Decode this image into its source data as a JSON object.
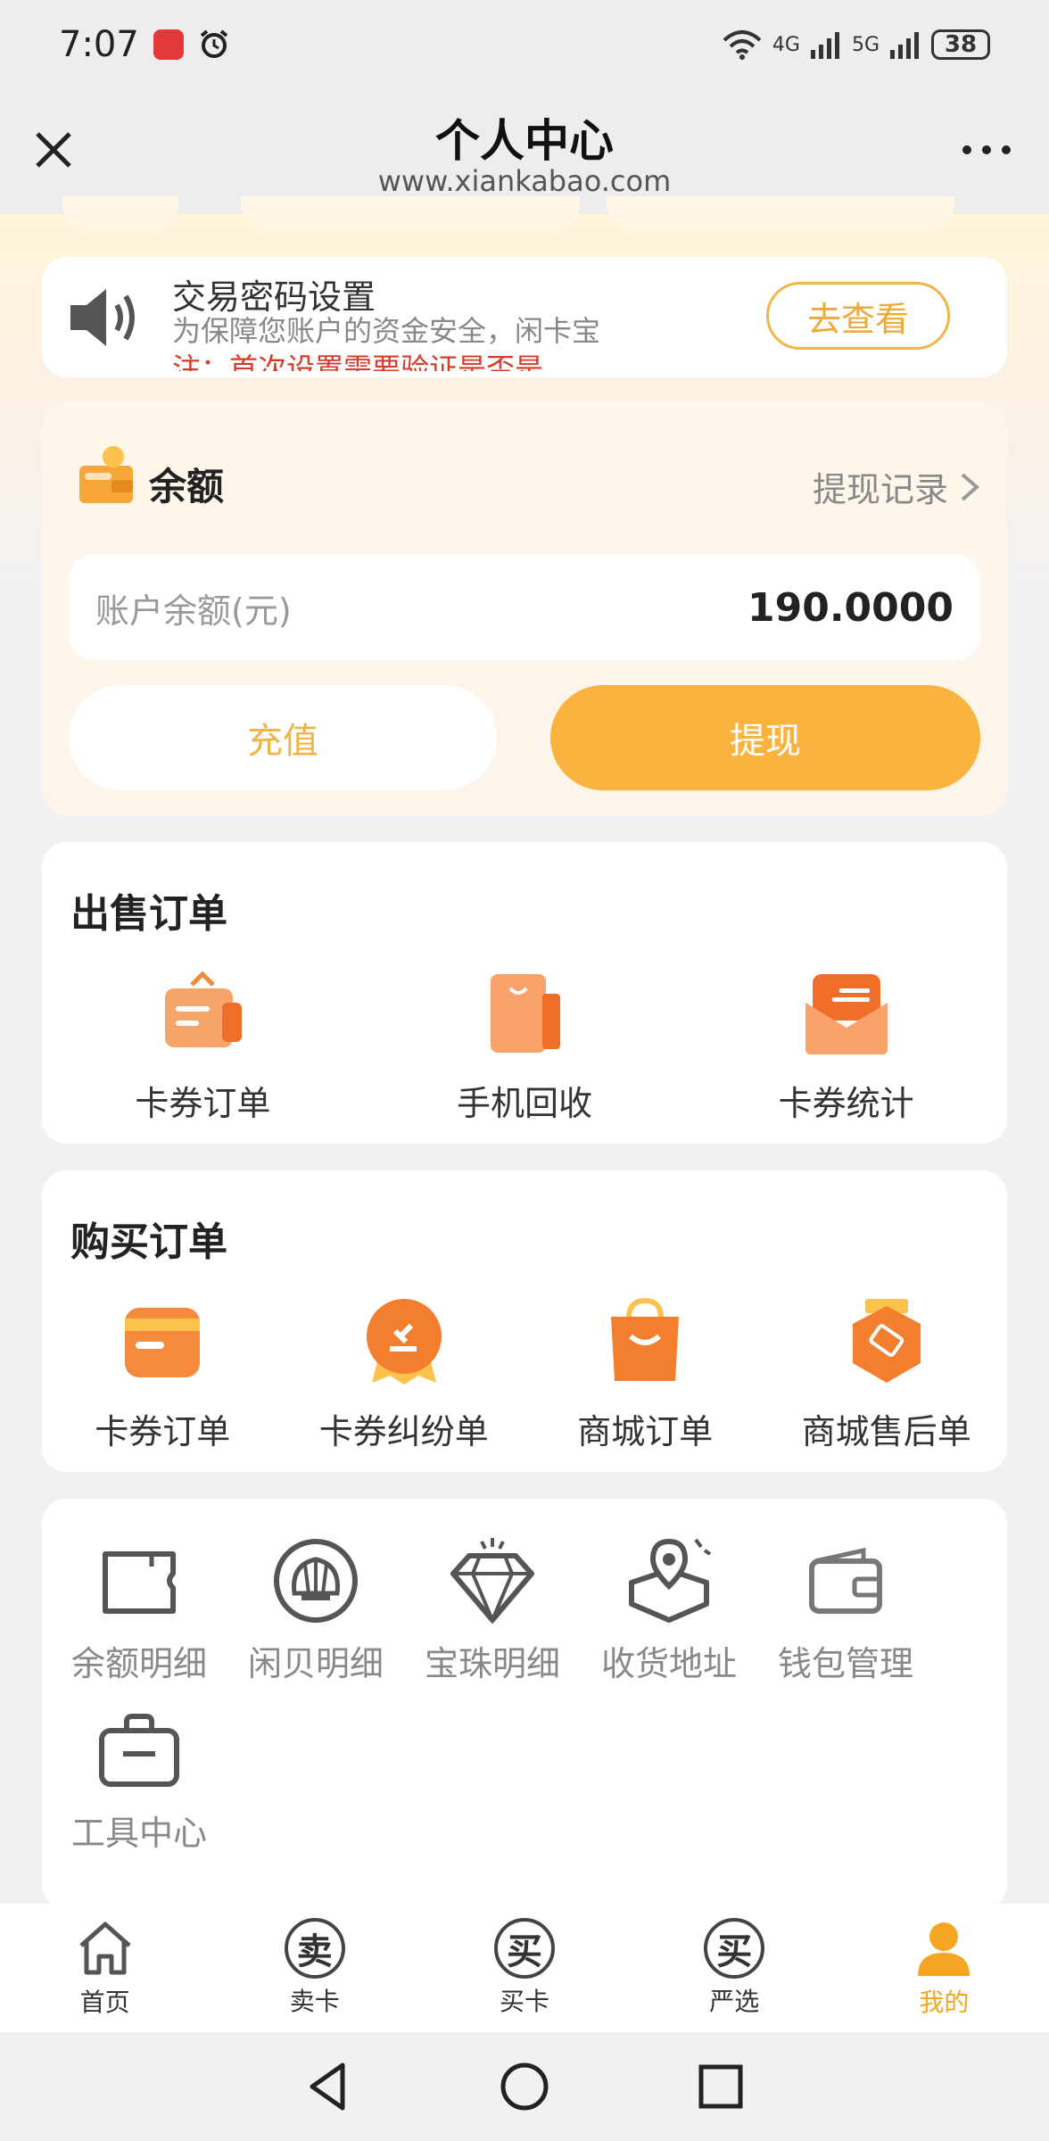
{
  "status_bar": {
    "time": "7:07",
    "network_1": "4G",
    "network_2": "5G",
    "battery": "38"
  },
  "header": {
    "title": "个人中心",
    "url": "www.xiankabao.com"
  },
  "notice": {
    "title": "交易密码设置",
    "text": "为保障您账户的资金安全，闲卡宝",
    "warning": "注：首次设置需要验证是否是",
    "button": "去查看"
  },
  "balance": {
    "title": "余额",
    "history_link": "提现记录",
    "account_label": "账户余额(元)",
    "account_value": "190.0000",
    "recharge_button": "充值",
    "withdraw_button": "提现"
  },
  "sell_orders": {
    "title": "出售订单",
    "items": [
      {
        "label": "卡券订单",
        "icon": "card-order-icon"
      },
      {
        "label": "手机回收",
        "icon": "phone-recycle-icon"
      },
      {
        "label": "卡券统计",
        "icon": "card-stats-icon"
      }
    ]
  },
  "buy_orders": {
    "title": "购买订单",
    "items": [
      {
        "label": "卡券订单",
        "icon": "card-order-icon"
      },
      {
        "label": "卡券纠纷单",
        "icon": "dispute-icon"
      },
      {
        "label": "商城订单",
        "icon": "mall-order-icon"
      },
      {
        "label": "商城售后单",
        "icon": "after-sale-icon"
      }
    ]
  },
  "tools": {
    "items": [
      {
        "label": "余额明细",
        "icon": "balance-detail-icon"
      },
      {
        "label": "闲贝明细",
        "icon": "shell-icon"
      },
      {
        "label": "宝珠明细",
        "icon": "diamond-icon"
      },
      {
        "label": "收货地址",
        "icon": "address-icon"
      },
      {
        "label": "钱包管理",
        "icon": "wallet-icon"
      },
      {
        "label": "工具中心",
        "icon": "toolbox-icon"
      }
    ]
  },
  "bottom_nav": {
    "items": [
      {
        "label": "首页",
        "glyph": ""
      },
      {
        "label": "卖卡",
        "glyph": "卖"
      },
      {
        "label": "买卡",
        "glyph": "买"
      },
      {
        "label": "严选",
        "glyph": "买"
      },
      {
        "label": "我的",
        "glyph": ""
      }
    ],
    "active_color": "#f5a623"
  },
  "colors": {
    "accent": "#fbb33f",
    "warning": "#d83a2a"
  }
}
